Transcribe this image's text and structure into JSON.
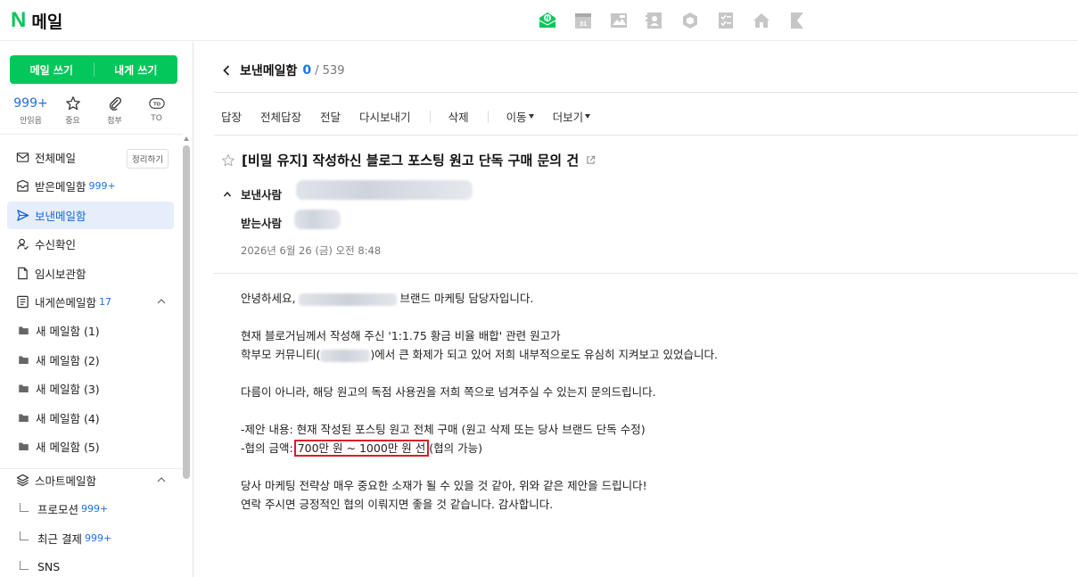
{
  "app": {
    "logo_mark": "N",
    "logo_text": "메일"
  },
  "top_apps": [
    {
      "name": "mail-app-icon",
      "color": "#03c75a"
    },
    {
      "name": "calendar-app-icon",
      "label": "31"
    },
    {
      "name": "photo-app-icon"
    },
    {
      "name": "contacts-app-icon"
    },
    {
      "name": "cube-app-icon"
    },
    {
      "name": "todo-app-icon"
    },
    {
      "name": "home-app-icon"
    },
    {
      "name": "bookmark-app-icon"
    }
  ],
  "sidebar": {
    "compose_label": "메일 쓰기",
    "self_compose_label": "내게 쓰기",
    "quick": [
      {
        "value": "999+",
        "label": "안읽음",
        "icon": "unread"
      },
      {
        "value": "",
        "label": "중요",
        "icon": "star-icon"
      },
      {
        "value": "",
        "label": "첨부",
        "icon": "paperclip-icon"
      },
      {
        "value": "TO",
        "label": "TO",
        "icon": "to-icon"
      }
    ],
    "folders": [
      {
        "label": "전체메일",
        "icon": "envelope-icon",
        "action": "정리하기"
      },
      {
        "label": "받은메일함",
        "icon": "inbox-icon",
        "count": "999+"
      },
      {
        "label": "보낸메일함",
        "icon": "send-icon",
        "active": true
      },
      {
        "label": "수신확인",
        "icon": "person-check-icon"
      },
      {
        "label": "임시보관함",
        "icon": "draft-icon"
      },
      {
        "label": "내게쓴메일함",
        "icon": "memo-icon",
        "count": "17",
        "expandable": true
      },
      {
        "label": "새 메일함 (1)",
        "icon": "folder-icon",
        "sub": true
      },
      {
        "label": "새 메일함 (2)",
        "icon": "folder-icon",
        "sub": true
      },
      {
        "label": "새 메일함 (3)",
        "icon": "folder-icon",
        "sub": true
      },
      {
        "label": "새 메일함 (4)",
        "icon": "folder-icon",
        "sub": true
      },
      {
        "label": "새 메일함 (5)",
        "icon": "folder-icon",
        "sub": true
      },
      {
        "label": "스마트메일함",
        "icon": "layers-icon",
        "expandable": true
      },
      {
        "label": "프로모션",
        "count": "999+",
        "child": true
      },
      {
        "label": "최근 결제",
        "count": "999+",
        "child": true
      },
      {
        "label": "SNS",
        "child": true
      }
    ]
  },
  "main": {
    "folder_title": "보낸메일함",
    "unread": "0",
    "total": "/ 539",
    "toolbar": {
      "reply": "답장",
      "reply_all": "전체답장",
      "forward": "전달",
      "resend": "다시보내기",
      "delete": "삭제",
      "move": "이동",
      "more": "더보기"
    },
    "subject": "[비밀 유지] 작성하신 블로그 포스팅 원고 단독 구매 문의 건",
    "sender_label": "보낸사람",
    "recipient_label": "받는사람",
    "date": "2026년 6월 26 (금) 오전 8:48",
    "body": {
      "greeting_prefix": "안녕하세요,",
      "greeting_suffix": "브랜드 마케팅 담당자입니다.",
      "p2_line1": "현재 블로거님께서 작성해 주신 '1:1.75 황금 비율 배합' 관련 원고가",
      "p2_line2_prefix": "학부모 커뮤니티(",
      "p2_line2_suffix": ")에서 큰 화제가 되고 있어 저희 내부적으로도 유심히 지켜보고 있었습니다.",
      "p3": "다름이 아니라, 해당 원고의 독점 사용권을 저희 쪽으로 넘겨주실 수 있는지 문의드립니다.",
      "offer_line": "-제안 내용: 현재 작성된 포스팅 원고 전체 구매 (원고 삭제 또는 당사 브랜드 단독 수정)",
      "amount_prefix": "-협의 금액:",
      "amount_value": "700만 원 ~ 1000만 원 선",
      "amount_suffix": "(협의 가능)",
      "closing1": "당사 마케팅 전략상 매우 중요한 소재가 될 수 있을 것 같아, 위와 같은 제안을 드립니다!",
      "closing2": "연락 주시면 긍정적인 협의 이뤄지면 좋을 것 같습니다. 감사합니다."
    },
    "highlight_color": "#d4202a"
  }
}
